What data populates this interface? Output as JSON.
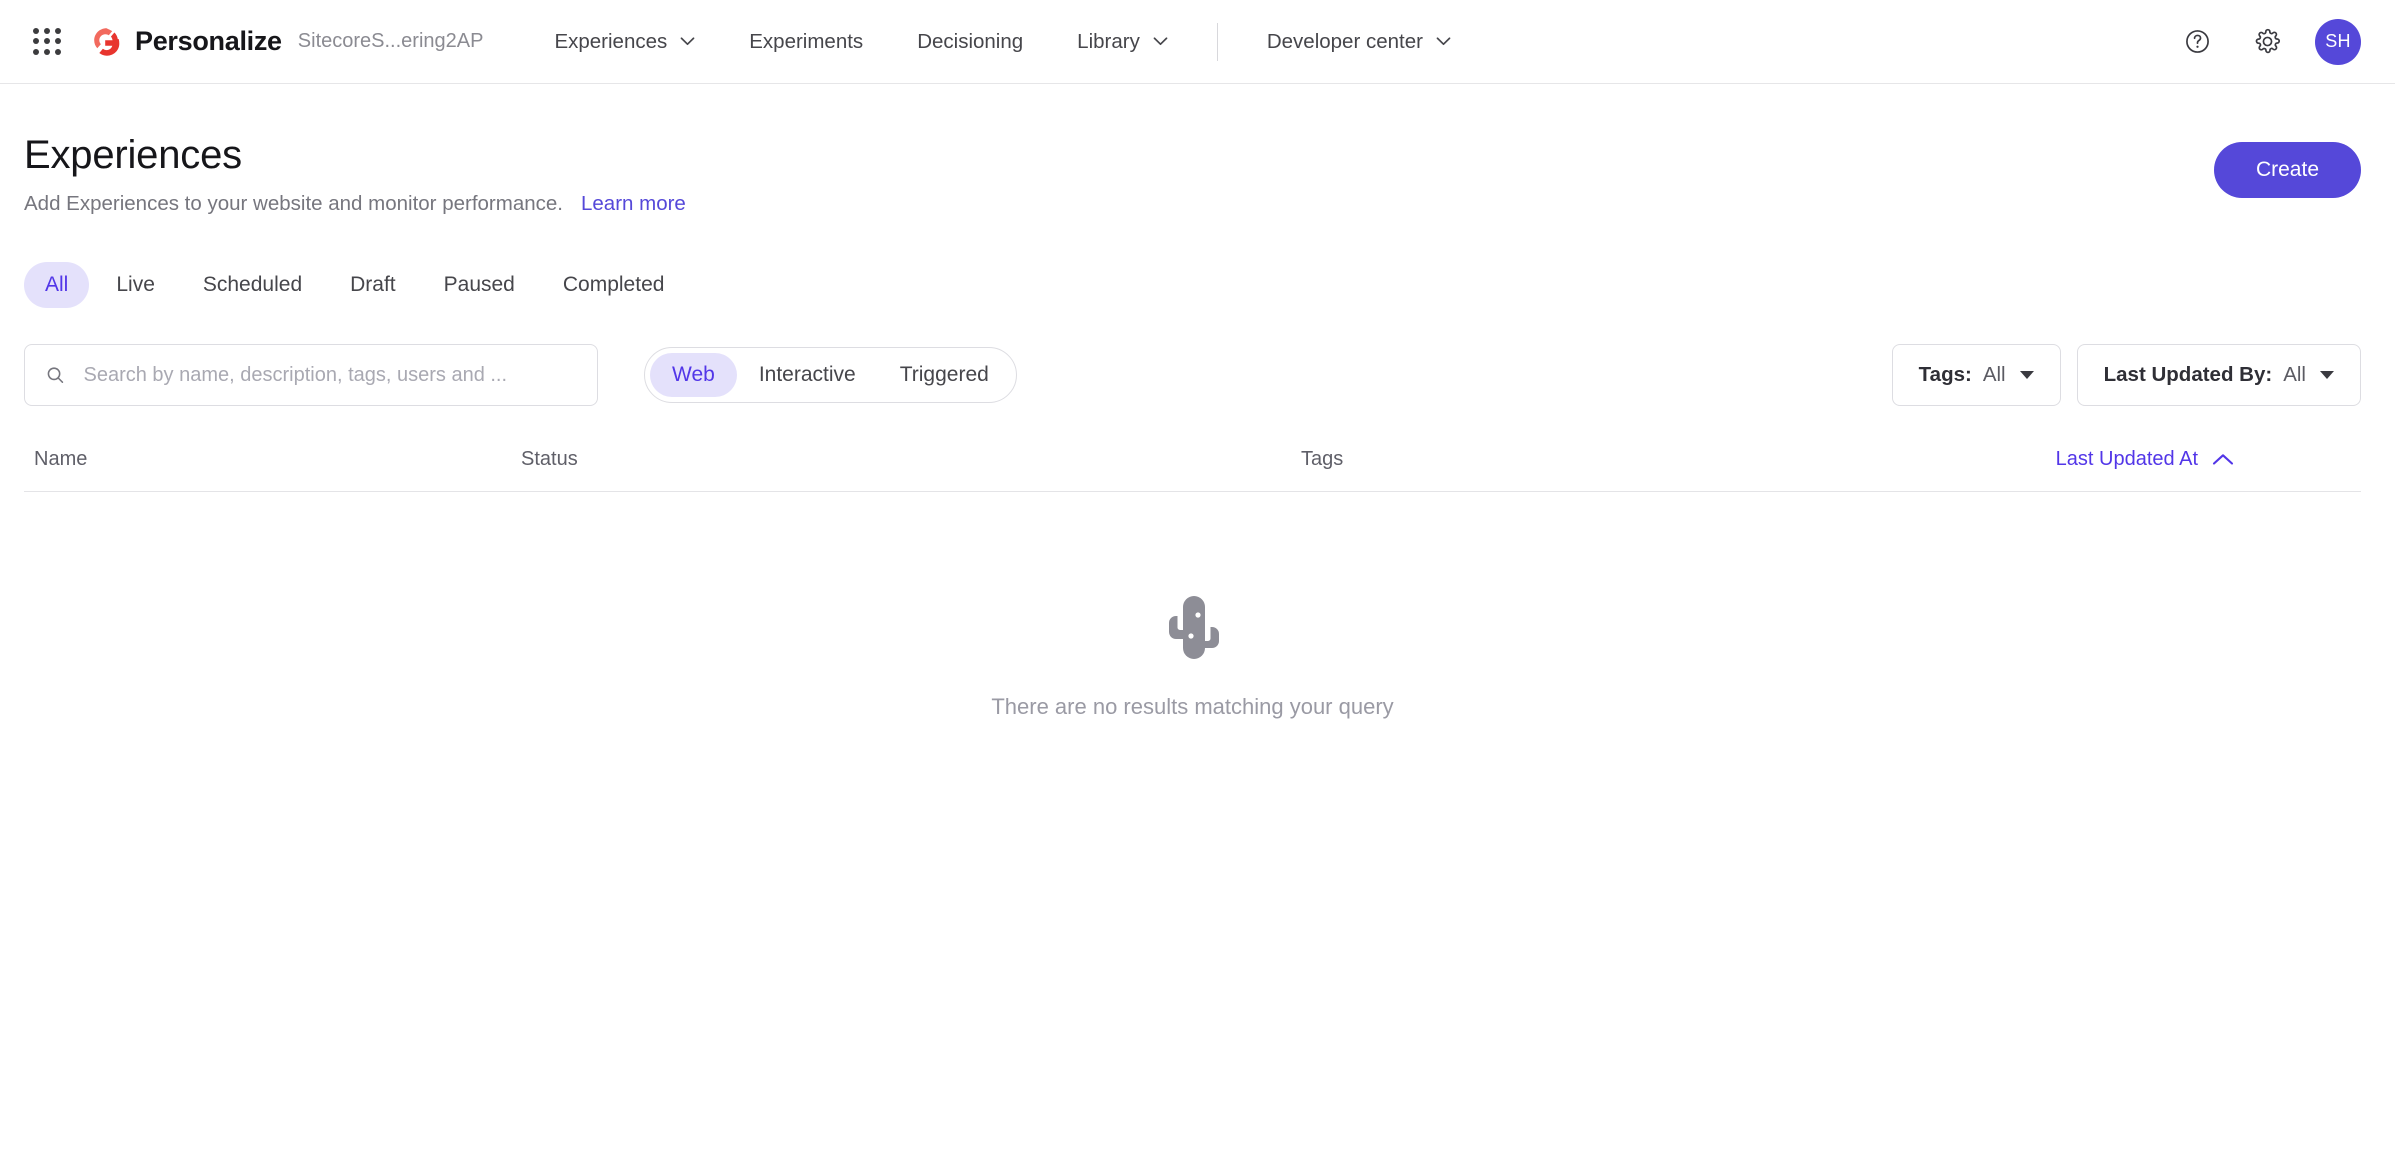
{
  "topnav": {
    "app_launcher_icon": "grid-apps-icon",
    "logo_icon": "sitecore-logo-icon",
    "brand_name": "Personalize",
    "tenant_name": "SitecoreS...ering2AP",
    "nav_items": [
      {
        "label": "Experiences",
        "has_chevron": true
      },
      {
        "label": "Experiments",
        "has_chevron": false
      },
      {
        "label": "Decisioning",
        "has_chevron": false
      },
      {
        "label": "Library",
        "has_chevron": true
      }
    ],
    "developer_center": {
      "label": "Developer center",
      "has_chevron": true
    },
    "help_icon": "help-circle-icon",
    "settings_icon": "gear-icon",
    "avatar_initials": "SH"
  },
  "page": {
    "title": "Experiences",
    "subtitle": "Add Experiences to your website and monitor performance.",
    "learn_more": "Learn more",
    "create_label": "Create"
  },
  "status_tabs": [
    {
      "label": "All",
      "active": true
    },
    {
      "label": "Live",
      "active": false
    },
    {
      "label": "Scheduled",
      "active": false
    },
    {
      "label": "Draft",
      "active": false
    },
    {
      "label": "Paused",
      "active": false
    },
    {
      "label": "Completed",
      "active": false
    }
  ],
  "search": {
    "icon": "search-icon",
    "value": "",
    "placeholder": "Search by name, description, tags, users and ..."
  },
  "segmented": [
    {
      "label": "Web",
      "active": true
    },
    {
      "label": "Interactive",
      "active": false
    },
    {
      "label": "Triggered",
      "active": false
    }
  ],
  "filters": {
    "tags": {
      "label": "Tags:",
      "value": "All",
      "caret_icon": "caret-down-icon"
    },
    "last_updated_by": {
      "label": "Last Updated By:",
      "value": "All",
      "caret_icon": "caret-down-icon"
    }
  },
  "table": {
    "columns": {
      "name": "Name",
      "status": "Status",
      "tags": "Tags",
      "last_updated_at": "Last Updated At"
    },
    "sort_icon": "chevron-up-icon",
    "sort_direction": "ascending",
    "rows": []
  },
  "empty_state": {
    "illustration": "cactus-icon",
    "message": "There are no results matching your query"
  },
  "colors": {
    "accent_purple": "#5548d9",
    "accent_purple_text": "#5236e8",
    "pill_bg": "#e4e1fb",
    "logo_red": "#e8352e",
    "muted_text": "#76767e",
    "empty_grey": "#9a9aa4"
  }
}
